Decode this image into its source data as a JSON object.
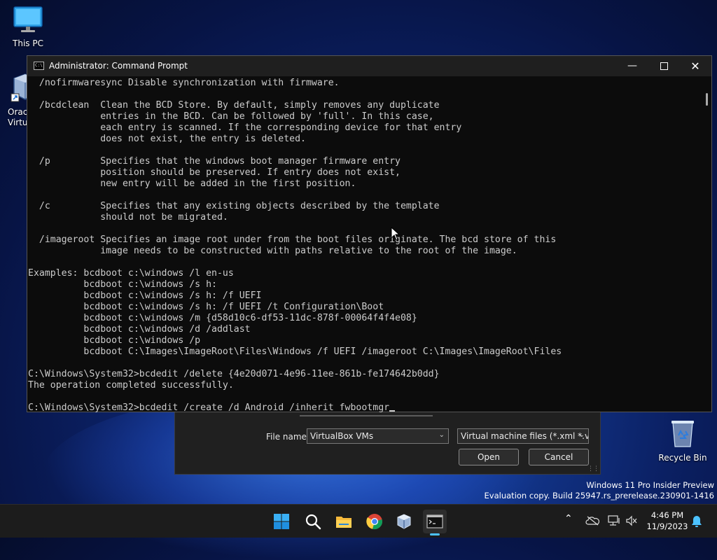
{
  "desktop": {
    "icons": [
      {
        "label": "This PC"
      },
      {
        "label": "Oracle VM VirtualBox",
        "visible_label": "Oracl\nVirtu"
      },
      {
        "label": "Recycle Bin"
      }
    ]
  },
  "file_dialog": {
    "file_name_label": "File name:",
    "file_name_value": "VirtualBox VMs",
    "file_type_value": "Virtual machine files (*.xml *.vb",
    "open_label": "Open",
    "cancel_label": "Cancel"
  },
  "console": {
    "title": "Administrator: Command Prompt",
    "lines": [
      "  /nofirmwaresync Disable synchronization with firmware.",
      "",
      "  /bcdclean  Clean the BCD Store. By default, simply removes any duplicate",
      "             entries in the BCD. Can be followed by 'full'. In this case,",
      "             each entry is scanned. If the corresponding device for that entry",
      "             does not exist, the entry is deleted.",
      "",
      "  /p         Specifies that the windows boot manager firmware entry",
      "             position should be preserved. If entry does not exist,",
      "             new entry will be added in the first position.",
      "",
      "  /c         Specifies that any existing objects described by the template",
      "             should not be migrated.",
      "",
      "  /imageroot Specifies an image root under from the boot files originate. The bcd store of this",
      "             image needs to be constructed with paths relative to the root of the image.",
      "",
      "Examples: bcdboot c:\\windows /l en-us",
      "          bcdboot c:\\windows /s h:",
      "          bcdboot c:\\windows /s h: /f UEFI",
      "          bcdboot c:\\windows /s h: /f UEFI /t Configuration\\Boot",
      "          bcdboot c:\\windows /m {d58d10c6-df53-11dc-878f-00064f4f4e08}",
      "          bcdboot c:\\windows /d /addlast",
      "          bcdboot c:\\windows /p",
      "          bcdboot C:\\Images\\ImageRoot\\Files\\Windows /f UEFI /imageroot C:\\Images\\ImageRoot\\Files",
      "",
      "C:\\Windows\\System32>bcdedit /delete {4e20d071-4e96-11ee-861b-fe174642b0dd}",
      "The operation completed successfully.",
      ""
    ],
    "prompt_line": "C:\\Windows\\System32>bcdedit /create /d Android /inherit fwbootmgr"
  },
  "watermark": {
    "line1": "Windows 11 Pro Insider Preview",
    "line2": "Evaluation copy. Build 25947.rs_prerelease.230901-1416"
  },
  "taskbar": {
    "apps": [
      "start-icon",
      "search-icon",
      "file-explorer-icon",
      "chrome-icon",
      "virtualbox-icon",
      "command-prompt-icon"
    ],
    "time": "4:46 PM",
    "date": "11/9/2023"
  },
  "colors": {
    "console_bg": "#0c0c0c",
    "console_text": "#cccccc",
    "taskbar_bg": "#1c1c1c",
    "accent": "#4cc2ff"
  }
}
